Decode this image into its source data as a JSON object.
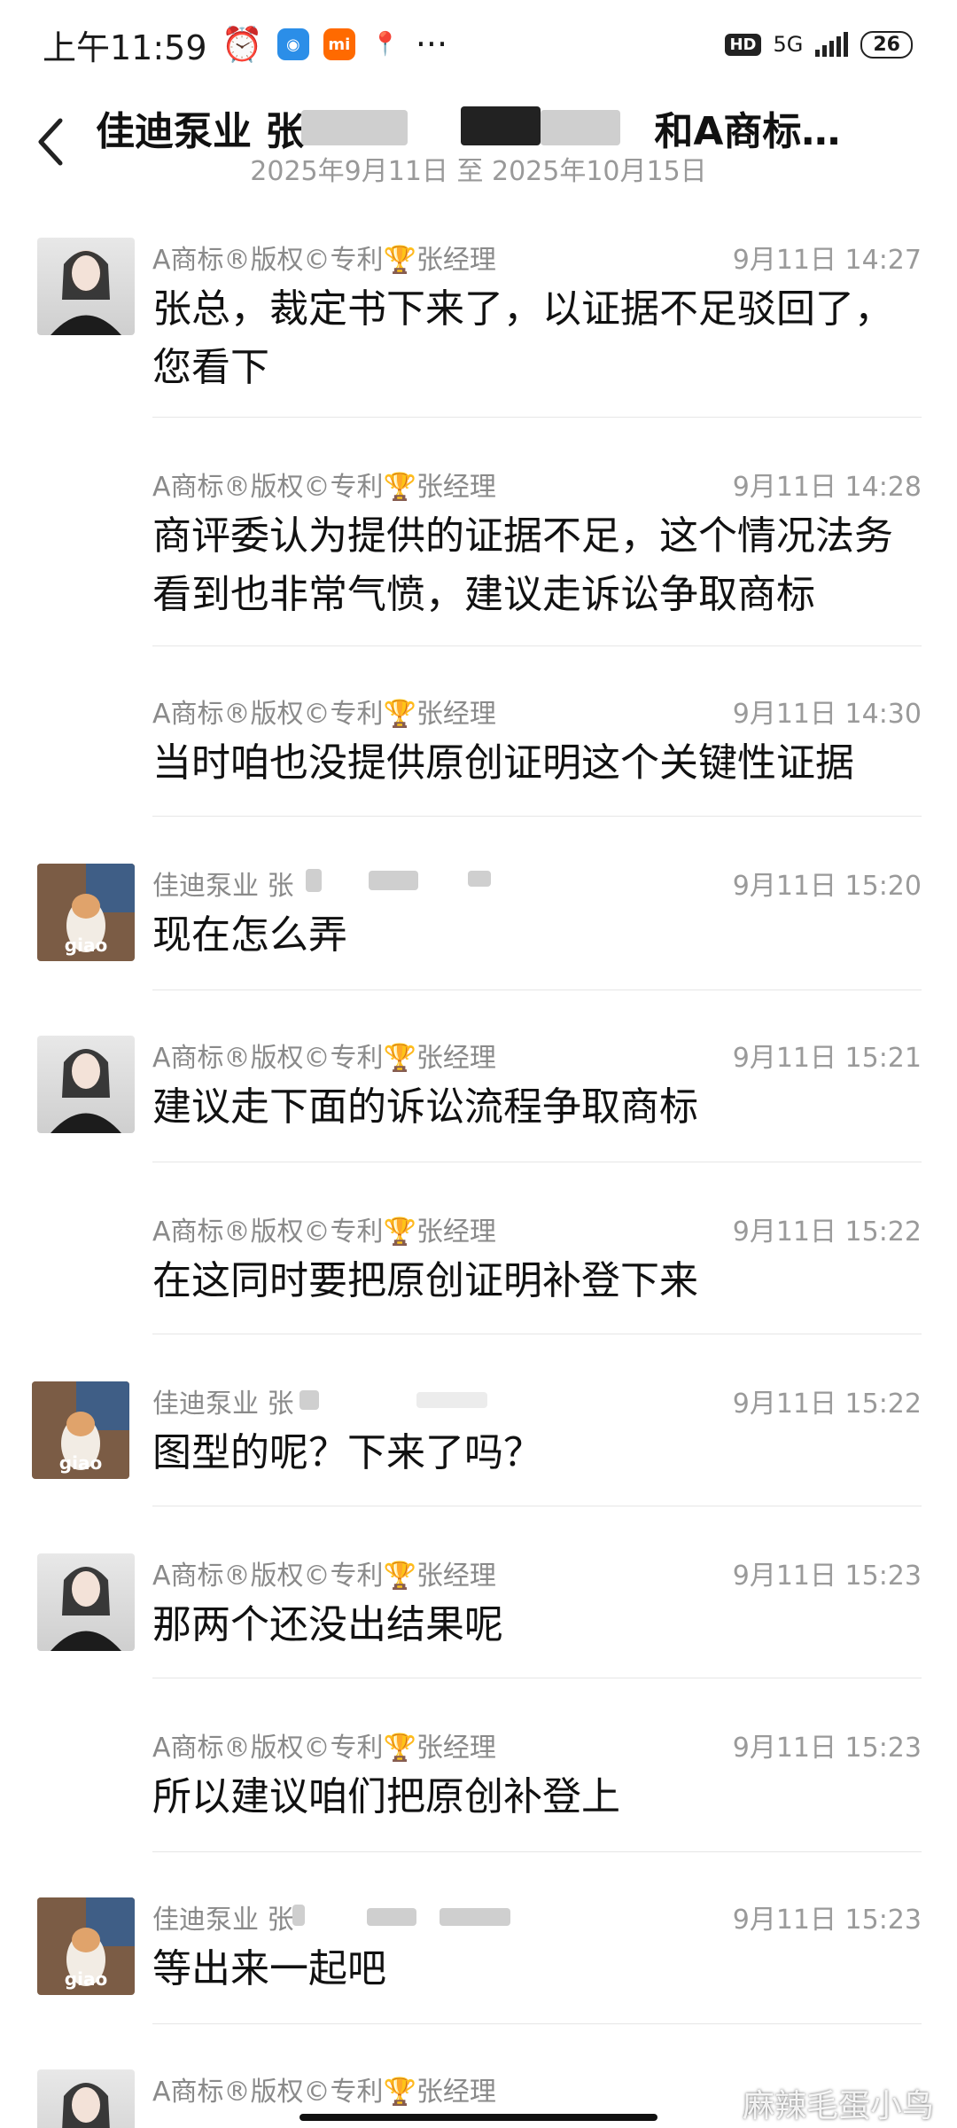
{
  "status": {
    "time": "上午11:59",
    "network": "5G",
    "hd": "HD",
    "battery": "26"
  },
  "header": {
    "title_left": "佳迪泵业 张",
    "title_right": "和A商标…",
    "date_range": "2025年9月11日 至 2025年10月15日"
  },
  "messages": [
    {
      "sender": "A商标®版权©专利🏆张经理",
      "time": "9月11日 14:27",
      "text": "张总，裁定书下来了，以证据不足驳回了，您看下"
    },
    {
      "sender": "A商标®版权©专利🏆张经理",
      "time": "9月11日 14:28",
      "text": "商评委认为提供的证据不足，这个情况法务看到也非常气愤，建议走诉讼争取商标"
    },
    {
      "sender": "A商标®版权©专利🏆张经理",
      "time": "9月11日 14:30",
      "text": "当时咱也没提供原创证明这个关键性证据"
    },
    {
      "sender": "佳迪泵业 张",
      "time": "9月11日 15:20",
      "text": "现在怎么弄"
    },
    {
      "sender": "A商标®版权©专利🏆张经理",
      "time": "9月11日 15:21",
      "text": "建议走下面的诉讼流程争取商标"
    },
    {
      "sender": "A商标®版权©专利🏆张经理",
      "time": "9月11日 15:22",
      "text": "在这同时要把原创证明补登下来"
    },
    {
      "sender": "佳迪泵业 张",
      "time": "9月11日 15:22",
      "text": "图型的呢？下来了吗？"
    },
    {
      "sender": "A商标®版权©专利🏆张经理",
      "time": "9月11日 15:23",
      "text": "那两个还没出结果呢"
    },
    {
      "sender": "A商标®版权©专利🏆张经理",
      "time": "9月11日 15:23",
      "text": "所以建议咱们把原创补登上"
    },
    {
      "sender": "佳迪泵业 张",
      "time": "9月11日 15:23",
      "text": "等出来一起吧"
    },
    {
      "sender": "A商标®版权©专利🏆张经理",
      "time": "",
      "text": ""
    }
  ],
  "avatars": {
    "cat_label": "giao"
  },
  "watermark": "麻辣毛蛋小鸟"
}
